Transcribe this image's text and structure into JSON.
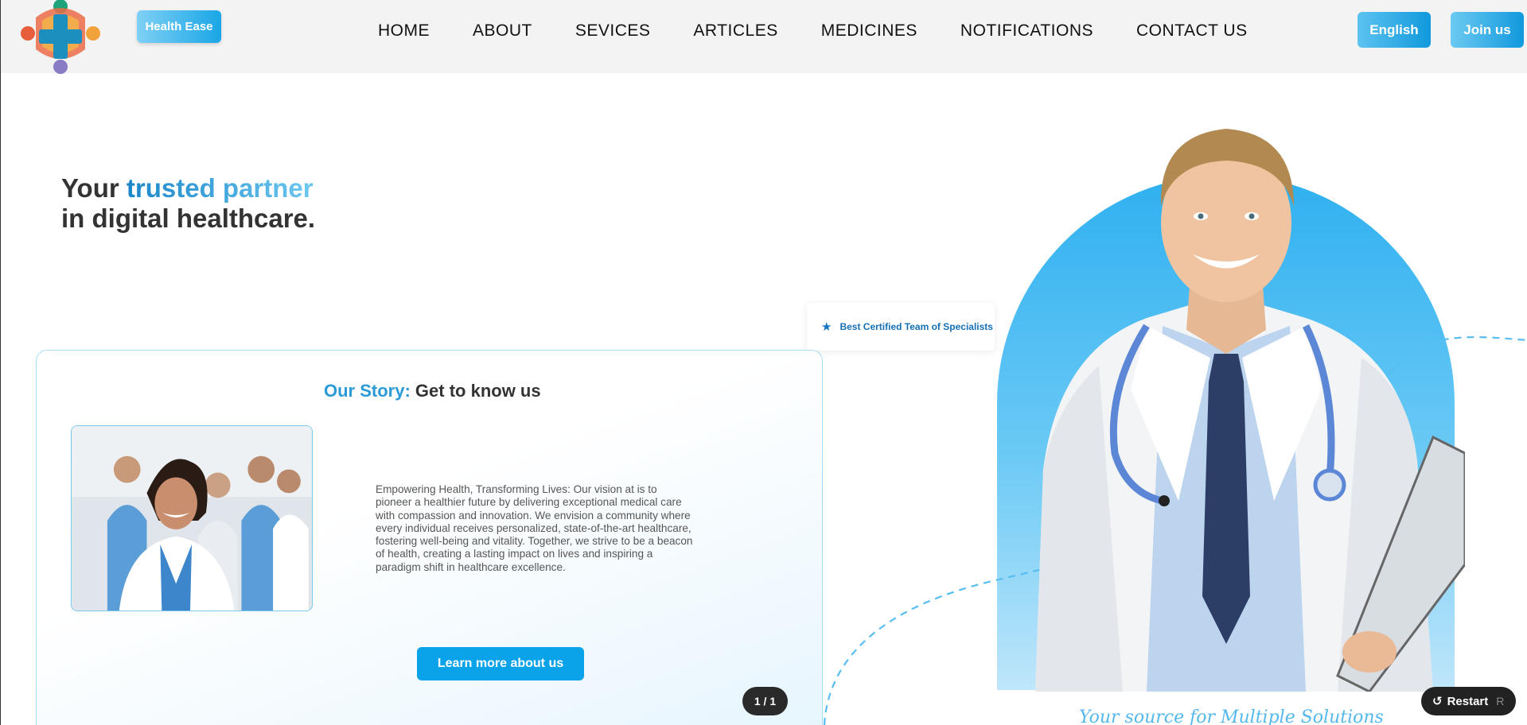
{
  "brand": {
    "button_label": "Health Ease"
  },
  "nav": {
    "links": [
      "HOME",
      "ABOUT",
      "SEVICES",
      "ARTICLES",
      "MEDICINES",
      "NOTIFICATIONS",
      "CONTACT US"
    ],
    "language_label": "English",
    "join_label": "Join us"
  },
  "hero": {
    "title_prefix": "Your",
    "title_accent": "trusted partner",
    "title_line2": "in digital healthcare."
  },
  "badge": {
    "icon": "star-icon",
    "text": "Best Certified Team of Specialists"
  },
  "story": {
    "title_accent": "Our Story:",
    "title_rest": "Get to know us",
    "body": "Empowering Health, Transforming Lives: Our vision at is to pioneer a healthier future by delivering exceptional medical care with compassion and innovation. We envision a community where every individual receives personalized, state-of-the-art healthcare, fostering well-being and vitality. Together, we strive to be a beacon of health, creating a lasting impact on lives and inspiring a paradigm shift in healthcare excellence.",
    "button_label": "Learn more about us",
    "pager": "1 / 1"
  },
  "tagline": "Your source for Multiple Solutions",
  "restart": {
    "label": "Restart",
    "shortcut": "R"
  },
  "colors": {
    "accent": "#0aa3ea",
    "accent_dark": "#1176c0",
    "nav_bg": "#f3f3f3"
  }
}
